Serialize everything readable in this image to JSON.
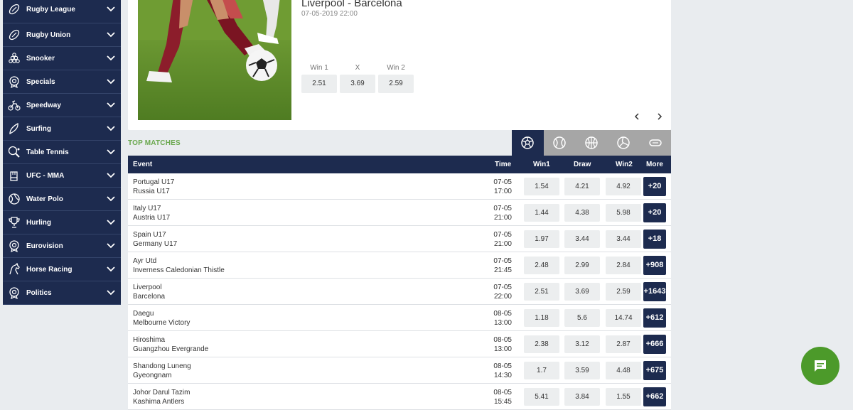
{
  "sidebar": {
    "items": [
      {
        "label": "Rugby League",
        "icon": "rugby-ball-icon"
      },
      {
        "label": "Rugby Union",
        "icon": "rugby-ball-icon"
      },
      {
        "label": "Snooker",
        "icon": "snooker-balls-icon"
      },
      {
        "label": "Specials",
        "icon": "specials-badge-icon"
      },
      {
        "label": "Speedway",
        "icon": "motorbike-icon"
      },
      {
        "label": "Surfing",
        "icon": "surfboard-icon"
      },
      {
        "label": "Table Tennis",
        "icon": "table-tennis-paddle-icon"
      },
      {
        "label": "UFC - MMA",
        "icon": "ufc-glove-icon"
      },
      {
        "label": "Water Polo",
        "icon": "water-polo-ball-icon"
      },
      {
        "label": "Hurling",
        "icon": "trophy-icon"
      },
      {
        "label": "Eurovision",
        "icon": "specials-badge-icon"
      },
      {
        "label": "Horse Racing",
        "icon": "horse-icon"
      },
      {
        "label": "Politics",
        "icon": "specials-badge-icon"
      }
    ]
  },
  "banner": {
    "title": "Liverpool - Barcelona",
    "date": "07-05-2019 22:00",
    "odds": [
      {
        "label": "Win 1",
        "value": "2.51"
      },
      {
        "label": "X",
        "value": "3.69"
      },
      {
        "label": "Win 2",
        "value": "2.59"
      }
    ]
  },
  "top_matches": {
    "title": "TOP MATCHES",
    "tabs": [
      "soccer-ball-icon",
      "tennis-ball-icon",
      "basketball-icon",
      "volleyball-icon",
      "american-football-icon"
    ],
    "headers": {
      "event": "Event",
      "time": "Time",
      "win1": "Win1",
      "draw": "Draw",
      "win2": "Win2",
      "more": "More"
    },
    "rows": [
      {
        "team1": "Portugal U17",
        "team2": "Russia U17",
        "date": "07-05",
        "time": "17:00",
        "win1": "1.54",
        "draw": "4.21",
        "win2": "4.92",
        "more": "+20"
      },
      {
        "team1": "Italy U17",
        "team2": "Austria U17",
        "date": "07-05",
        "time": "21:00",
        "win1": "1.44",
        "draw": "4.38",
        "win2": "5.98",
        "more": "+20"
      },
      {
        "team1": "Spain U17",
        "team2": "Germany U17",
        "date": "07-05",
        "time": "21:00",
        "win1": "1.97",
        "draw": "3.44",
        "win2": "3.44",
        "more": "+18"
      },
      {
        "team1": "Ayr Utd",
        "team2": "Inverness Caledonian Thistle",
        "date": "07-05",
        "time": "21:45",
        "win1": "2.48",
        "draw": "2.99",
        "win2": "2.84",
        "more": "+908"
      },
      {
        "team1": "Liverpool",
        "team2": "Barcelona",
        "date": "07-05",
        "time": "22:00",
        "win1": "2.51",
        "draw": "3.69",
        "win2": "2.59",
        "more": "+1643"
      },
      {
        "team1": "Daegu",
        "team2": "Melbourne Victory",
        "date": "08-05",
        "time": "13:00",
        "win1": "1.18",
        "draw": "5.6",
        "win2": "14.74",
        "more": "+612"
      },
      {
        "team1": "Hiroshima",
        "team2": "Guangzhou Evergrande",
        "date": "08-05",
        "time": "13:00",
        "win1": "2.38",
        "draw": "3.12",
        "win2": "2.87",
        "more": "+666"
      },
      {
        "team1": "Shandong Luneng",
        "team2": "Gyeongnam",
        "date": "08-05",
        "time": "14:30",
        "win1": "1.7",
        "draw": "3.59",
        "win2": "4.48",
        "more": "+675"
      },
      {
        "team1": "Johor Darul Tazim",
        "team2": "Kashima Antlers",
        "date": "08-05",
        "time": "15:45",
        "win1": "5.41",
        "draw": "3.84",
        "win2": "1.55",
        "more": "+662"
      }
    ]
  },
  "colors": {
    "navy": "#1d2b4f",
    "green": "#6aa84f",
    "chat": "#4c9a2a"
  }
}
